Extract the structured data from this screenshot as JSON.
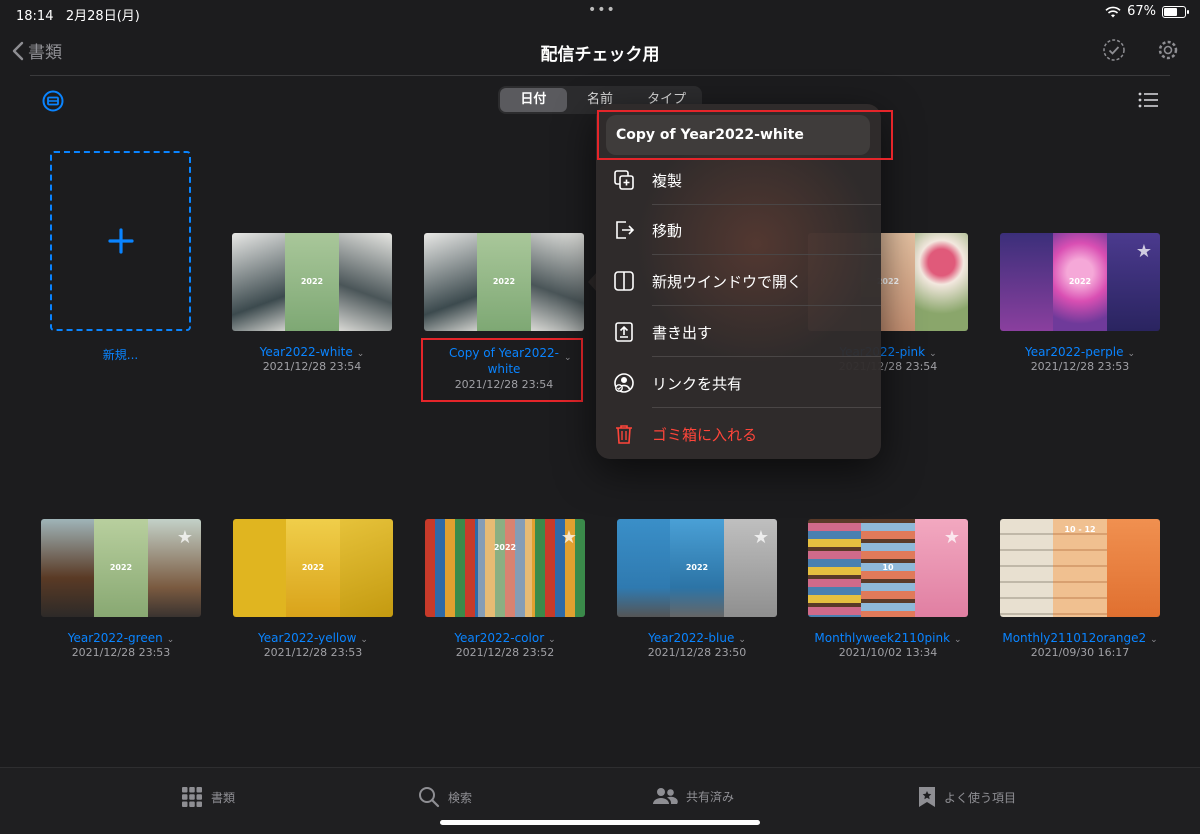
{
  "status": {
    "time": "18:14",
    "date": "2月28日(月)",
    "battery": "67%",
    "battery_level": 0.67
  },
  "nav": {
    "back_label": "書類",
    "title": "配信チェック用"
  },
  "sort": {
    "options": [
      "日付",
      "名前",
      "タイプ"
    ],
    "selected": "日付"
  },
  "new_doc_label": "新規...",
  "row1": [
    {
      "name": "Year2022-white",
      "date": "2021/12/28 23:54"
    },
    {
      "name": "Copy of Year2022-\nwhite",
      "date": "2021/12/28 23:54"
    },
    {
      "name": "Year2022-pink",
      "date": "2021/12/28 23:54"
    },
    {
      "name": "Year2022-perple",
      "date": "2021/12/28 23:53"
    }
  ],
  "row2": [
    {
      "name": "Year2022-green",
      "date": "2021/12/28 23:53"
    },
    {
      "name": "Year2022-yellow",
      "date": "2021/12/28 23:53"
    },
    {
      "name": "Year2022-color",
      "date": "2021/12/28 23:52"
    },
    {
      "name": "Year2022-blue",
      "date": "2021/12/28 23:50"
    },
    {
      "name": "Monthlyweek2110pink",
      "date": "2021/10/02 13:34"
    },
    {
      "name": "Monthly211012orange2",
      "date": "2021/09/30 16:17"
    }
  ],
  "thumb_year": "2022",
  "thumb_month": "10",
  "thumb_month_range": "10 - 12",
  "context_menu": {
    "title": "Copy of Year2022-white",
    "items": [
      "複製",
      "移動",
      "新規ウインドウで開く",
      "書き出す",
      "リンクを共有",
      "ゴミ箱に入れる"
    ]
  },
  "tabs": [
    "書類",
    "検索",
    "共有済み",
    "よく使う項目"
  ],
  "colors": {
    "accent": "#0a84ff",
    "danger": "#ff453a",
    "highlight": "#e5252a"
  }
}
